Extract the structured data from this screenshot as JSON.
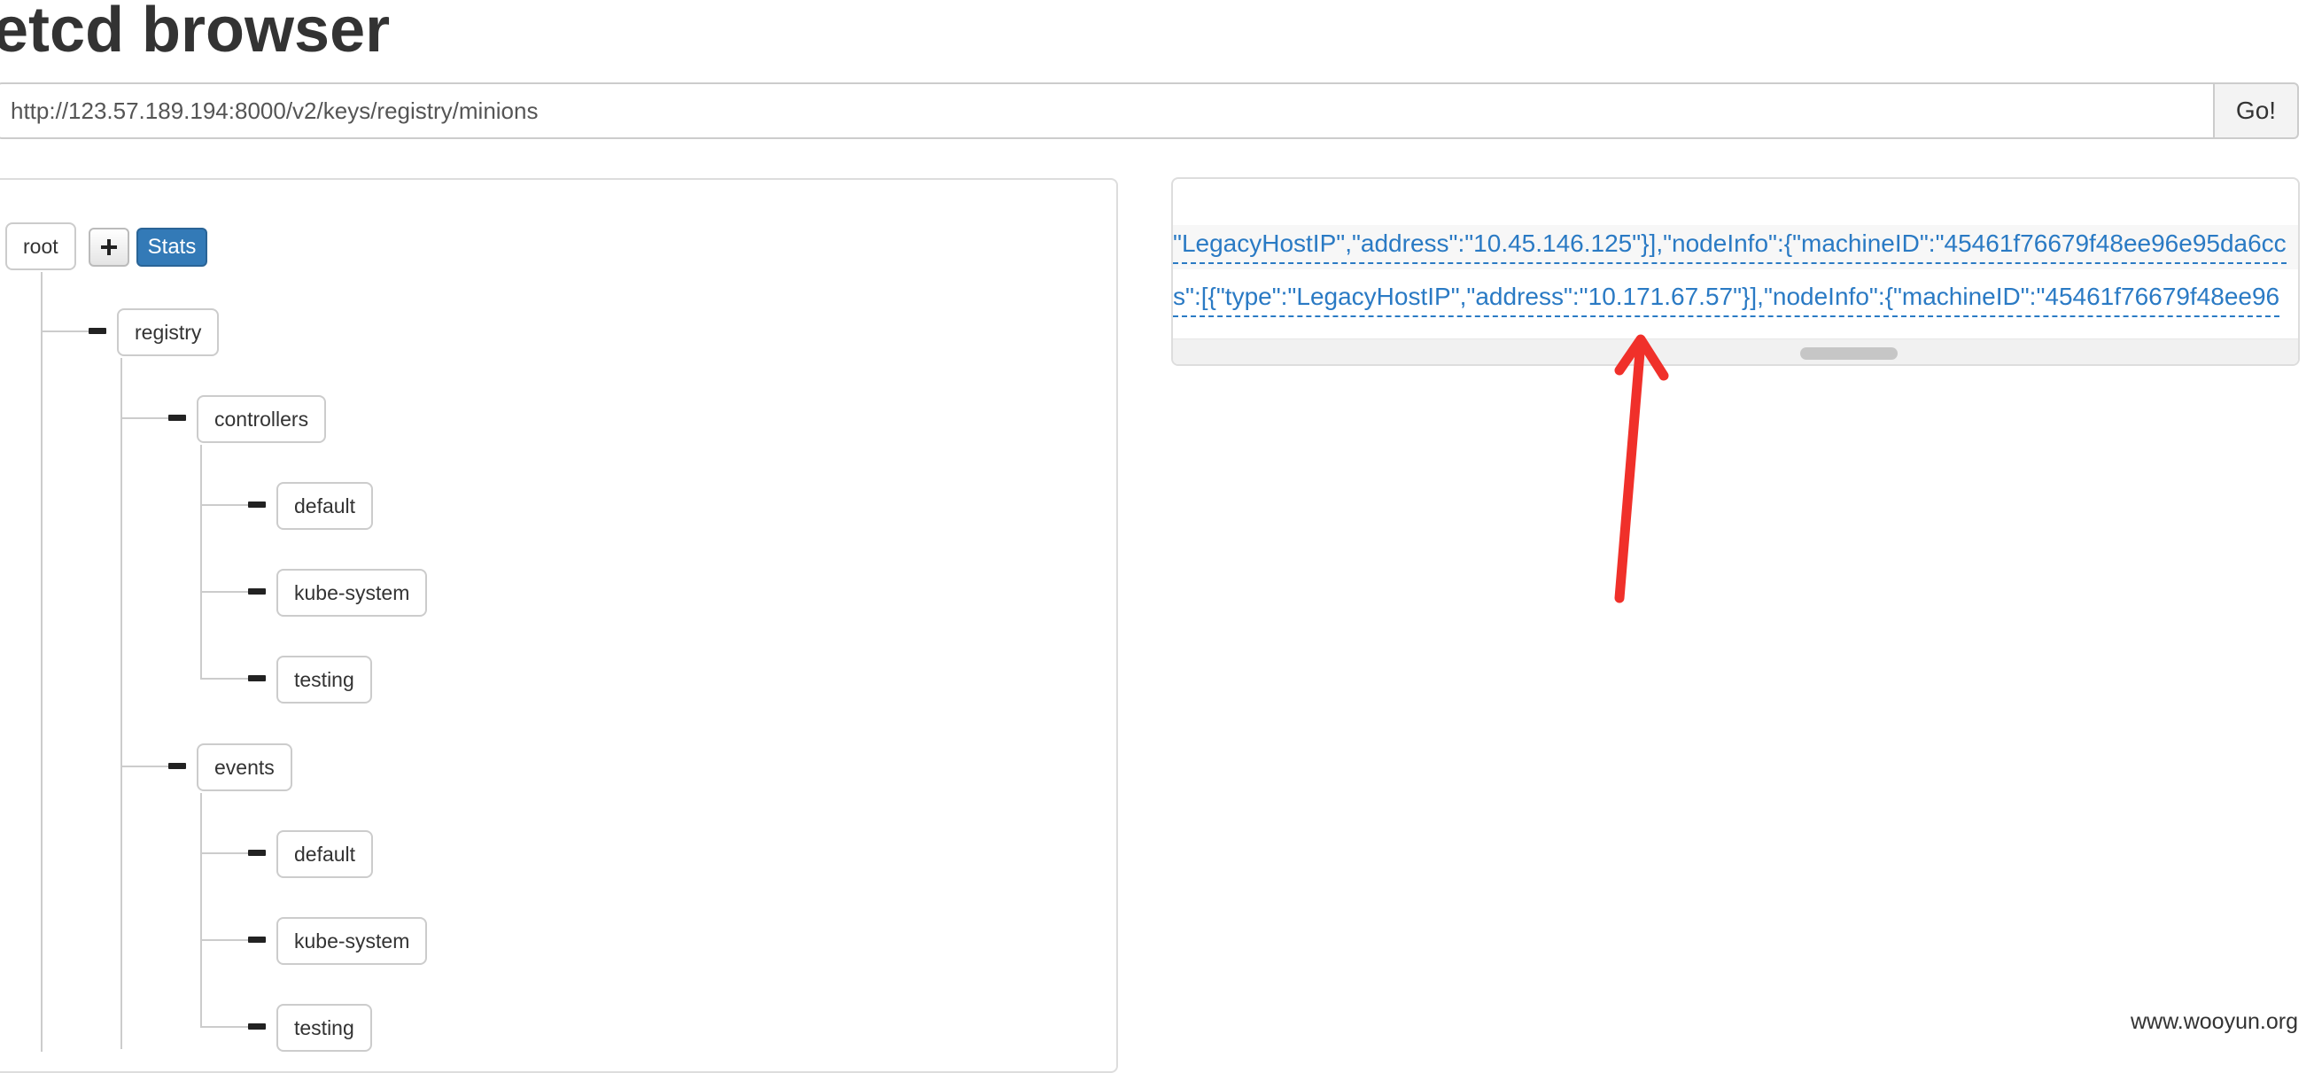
{
  "page": {
    "title": "etcd browser"
  },
  "url_bar": {
    "value": "http://123.57.189.194:8000/v2/keys/registry/minions"
  },
  "go_button": {
    "label": "Go!"
  },
  "tree": {
    "root": {
      "label": "root",
      "add_icon": "plus-icon",
      "stats_label": "Stats"
    },
    "registry": {
      "label": "registry",
      "controllers": {
        "label": "controllers",
        "children": [
          "default",
          "kube-system",
          "testing"
        ]
      },
      "events": {
        "label": "events",
        "children": [
          "default",
          "kube-system",
          "testing"
        ]
      }
    }
  },
  "value_panel": {
    "lines": [
      "\"LegacyHostIP\",\"address\":\"10.45.146.125\"}],\"nodeInfo\":{\"machineID\":\"45461f76679f48ee96e95da6cc",
      "s\":[{\"type\":\"LegacyHostIP\",\"address\":\"10.171.67.57\"}],\"nodeInfo\":{\"machineID\":\"45461f76679f48ee96"
    ]
  },
  "annotation": {
    "arrow_color": "#f0302a"
  },
  "watermark": "www.wooyun.org",
  "colors": {
    "link": "#2a7ac4",
    "stats_button": "#337ab7",
    "border": "#cccccc"
  }
}
